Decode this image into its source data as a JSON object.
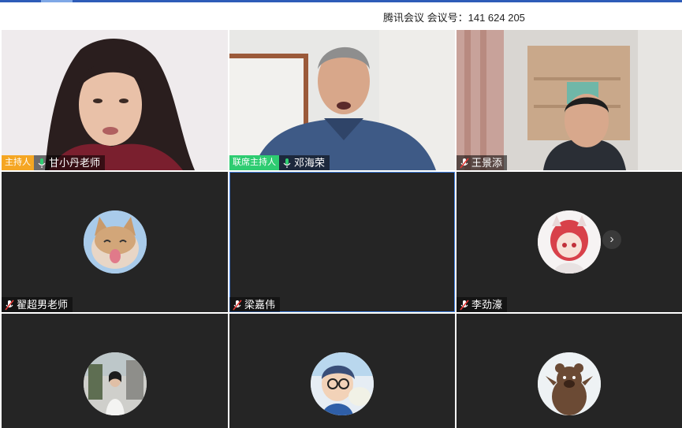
{
  "app": {
    "title": "腾讯会议 会议号：141 624 205"
  },
  "colors": {
    "host_badge": "#F5A623",
    "cohost_badge": "#2ECC71",
    "active_border": "#3D7CE0",
    "tile_bg": "#252525"
  },
  "participants": [
    {
      "name": "甘小丹老师",
      "role": "主持人",
      "mic": "on"
    },
    {
      "name": "邓海荣",
      "role": "联席主持人",
      "mic": "on"
    },
    {
      "name": "王景添",
      "role": "",
      "mic": "off"
    },
    {
      "name": "翟超男老师",
      "role": "",
      "mic": "off"
    },
    {
      "name": "梁嘉伟",
      "role": "",
      "mic": "off"
    },
    {
      "name": "李劲濠",
      "role": "",
      "mic": "off"
    }
  ],
  "controls": {
    "next_page_icon": "chevron-right-icon",
    "next_page_glyph": "›"
  }
}
